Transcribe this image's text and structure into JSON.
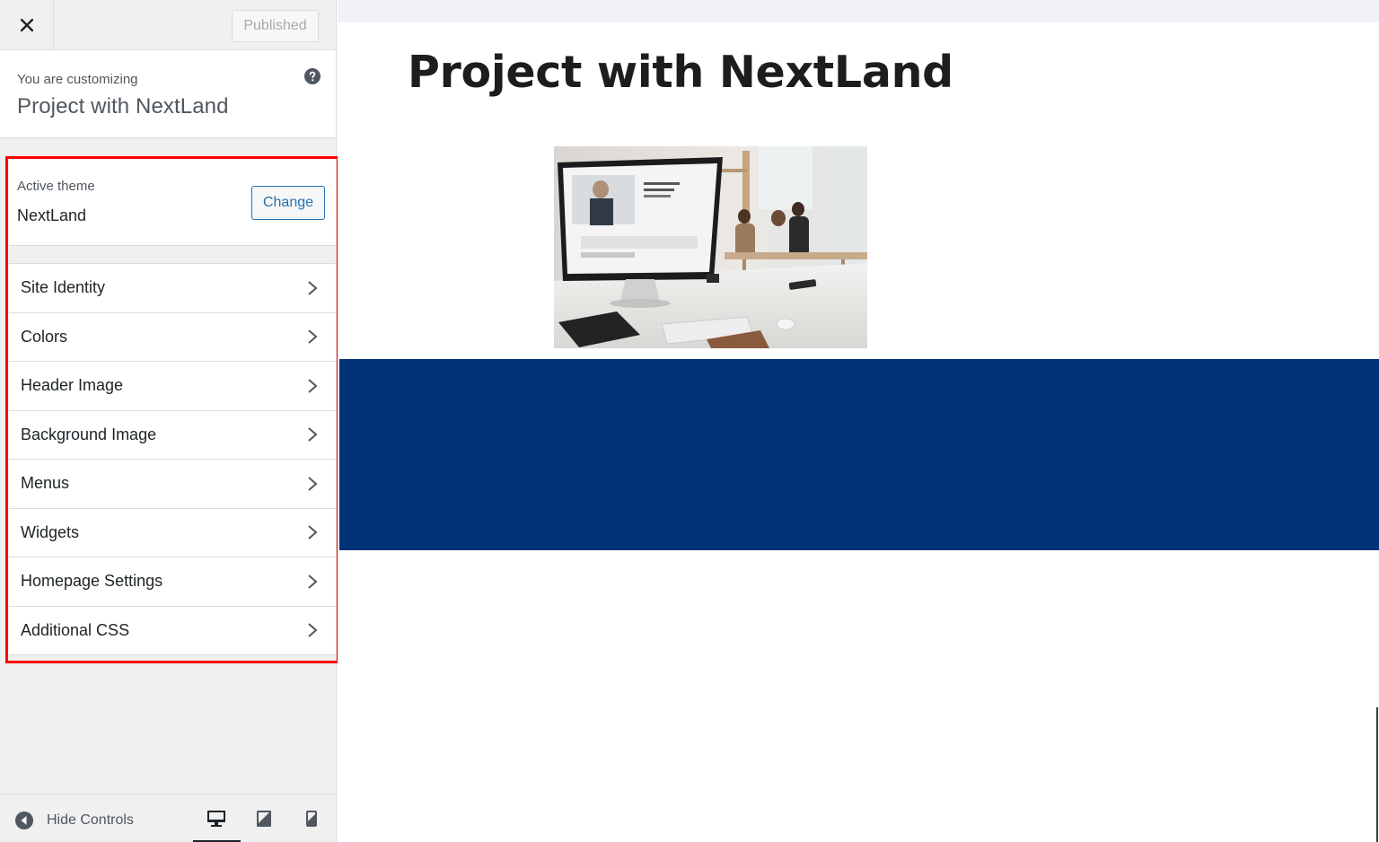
{
  "header": {
    "close_icon": "close-icon",
    "publish_label": "Published"
  },
  "info": {
    "kicker": "You are customizing",
    "site_title": "Project with NextLand",
    "help_icon": "help-icon"
  },
  "theme": {
    "label": "Active theme",
    "name": "NextLand",
    "change_label": "Change"
  },
  "panels": [
    {
      "title": "Site Identity"
    },
    {
      "title": "Colors"
    },
    {
      "title": "Header Image"
    },
    {
      "title": "Background Image"
    },
    {
      "title": "Menus"
    },
    {
      "title": "Widgets"
    },
    {
      "title": "Homepage Settings"
    },
    {
      "title": "Additional CSS"
    }
  ],
  "footer": {
    "hide_controls_label": "Hide Controls",
    "devices": [
      "desktop",
      "tablet",
      "mobile"
    ],
    "active_device": "desktop"
  },
  "preview": {
    "page_heading": "Project with NextLand",
    "band_color": "#013278"
  },
  "colors": {
    "accent": "#2271b1",
    "highlight": "#ff0000",
    "navy": "#013278"
  }
}
